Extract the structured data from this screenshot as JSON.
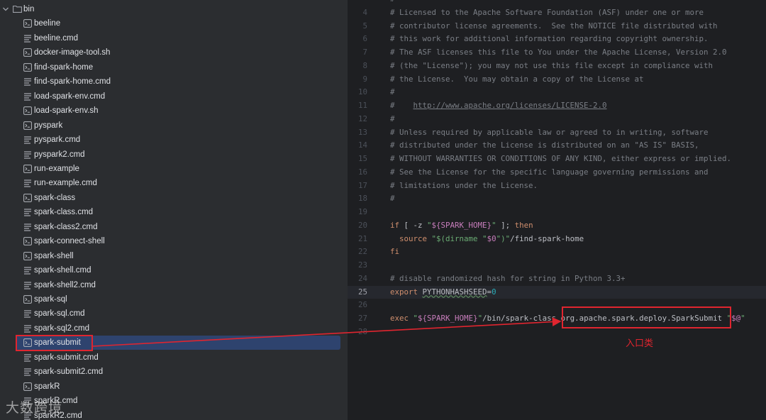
{
  "project_tree": {
    "folder": {
      "name": "bin",
      "expanded": true
    },
    "files": [
      {
        "name": "beeline",
        "icon": "terminal-icon"
      },
      {
        "name": "beeline.cmd",
        "icon": "text-file-icon"
      },
      {
        "name": "docker-image-tool.sh",
        "icon": "terminal-icon"
      },
      {
        "name": "find-spark-home",
        "icon": "terminal-icon"
      },
      {
        "name": "find-spark-home.cmd",
        "icon": "text-file-icon"
      },
      {
        "name": "load-spark-env.cmd",
        "icon": "text-file-icon"
      },
      {
        "name": "load-spark-env.sh",
        "icon": "terminal-icon"
      },
      {
        "name": "pyspark",
        "icon": "terminal-icon"
      },
      {
        "name": "pyspark.cmd",
        "icon": "text-file-icon"
      },
      {
        "name": "pyspark2.cmd",
        "icon": "text-file-icon"
      },
      {
        "name": "run-example",
        "icon": "terminal-icon"
      },
      {
        "name": "run-example.cmd",
        "icon": "text-file-icon"
      },
      {
        "name": "spark-class",
        "icon": "terminal-icon"
      },
      {
        "name": "spark-class.cmd",
        "icon": "text-file-icon"
      },
      {
        "name": "spark-class2.cmd",
        "icon": "text-file-icon"
      },
      {
        "name": "spark-connect-shell",
        "icon": "terminal-icon"
      },
      {
        "name": "spark-shell",
        "icon": "terminal-icon"
      },
      {
        "name": "spark-shell.cmd",
        "icon": "text-file-icon"
      },
      {
        "name": "spark-shell2.cmd",
        "icon": "text-file-icon"
      },
      {
        "name": "spark-sql",
        "icon": "terminal-icon"
      },
      {
        "name": "spark-sql.cmd",
        "icon": "text-file-icon"
      },
      {
        "name": "spark-sql2.cmd",
        "icon": "text-file-icon"
      },
      {
        "name": "spark-submit",
        "icon": "terminal-icon",
        "selected": true
      },
      {
        "name": "spark-submit.cmd",
        "icon": "text-file-icon"
      },
      {
        "name": "spark-submit2.cmd",
        "icon": "text-file-icon"
      },
      {
        "name": "sparkR",
        "icon": "terminal-icon"
      },
      {
        "name": "sparkR.cmd",
        "icon": "text-file-icon"
      },
      {
        "name": "sparkR2.cmd",
        "icon": "text-file-icon"
      }
    ]
  },
  "editor": {
    "current_line": 25,
    "lines": [
      {
        "n": "",
        "t": [
          [
            "c",
            "#"
          ]
        ]
      },
      {
        "n": "4",
        "t": [
          [
            "c",
            "# Licensed to the Apache Software Foundation (ASF) under one or more"
          ]
        ]
      },
      {
        "n": "5",
        "t": [
          [
            "c",
            "# contributor license agreements.  See the NOTICE file distributed with"
          ]
        ]
      },
      {
        "n": "6",
        "t": [
          [
            "c",
            "# this work for additional information regarding copyright ownership."
          ]
        ]
      },
      {
        "n": "7",
        "t": [
          [
            "c",
            "# The ASF licenses this file to You under the Apache License, Version 2.0"
          ]
        ]
      },
      {
        "n": "8",
        "t": [
          [
            "c",
            "# (the \"License\"); you may not use this file except in compliance with"
          ]
        ]
      },
      {
        "n": "9",
        "t": [
          [
            "c",
            "# the License.  You may obtain a copy of the License at"
          ]
        ]
      },
      {
        "n": "10",
        "t": [
          [
            "c",
            "#"
          ]
        ]
      },
      {
        "n": "11",
        "t": [
          [
            "c",
            "#    "
          ],
          [
            "l",
            "http://www.apache.org/licenses/LICENSE-2.0"
          ]
        ]
      },
      {
        "n": "12",
        "t": [
          [
            "c",
            "#"
          ]
        ]
      },
      {
        "n": "13",
        "t": [
          [
            "c",
            "# Unless required by applicable law or agreed to in writing, software"
          ]
        ]
      },
      {
        "n": "14",
        "t": [
          [
            "c",
            "# distributed under the License is distributed on an \"AS IS\" BASIS,"
          ]
        ]
      },
      {
        "n": "15",
        "t": [
          [
            "c",
            "# WITHOUT WARRANTIES OR CONDITIONS OF ANY KIND, either express or implied."
          ]
        ]
      },
      {
        "n": "16",
        "t": [
          [
            "c",
            "# See the License for the specific language governing permissions and"
          ]
        ]
      },
      {
        "n": "17",
        "t": [
          [
            "c",
            "# limitations under the License."
          ]
        ]
      },
      {
        "n": "18",
        "t": [
          [
            "c",
            "#"
          ]
        ]
      },
      {
        "n": "19",
        "t": []
      },
      {
        "n": "20",
        "t": [
          [
            "k",
            "if"
          ],
          [
            "p",
            " [ -z "
          ],
          [
            "s",
            "\""
          ],
          [
            "v",
            "${SPARK_HOME}"
          ],
          [
            "s",
            "\""
          ],
          [
            "p",
            " ]; "
          ],
          [
            "k",
            "then"
          ]
        ]
      },
      {
        "n": "21",
        "t": [
          [
            "p",
            "  "
          ],
          [
            "k",
            "source"
          ],
          [
            "p",
            " "
          ],
          [
            "s",
            "\"$(dirname \""
          ],
          [
            "v",
            "$0"
          ],
          [
            "s",
            "\")\""
          ],
          [
            "p",
            "/find-spark-home"
          ]
        ]
      },
      {
        "n": "22",
        "t": [
          [
            "k",
            "fi"
          ]
        ]
      },
      {
        "n": "23",
        "t": []
      },
      {
        "n": "24",
        "t": [
          [
            "c",
            "# disable randomized hash for string in Python 3.3+"
          ]
        ]
      },
      {
        "n": "25",
        "t": [
          [
            "k",
            "export"
          ],
          [
            "p",
            " "
          ],
          [
            "w",
            "PYTHONHASHSEED"
          ],
          [
            "p",
            "="
          ],
          [
            "d",
            "0"
          ]
        ]
      },
      {
        "n": "26",
        "t": []
      },
      {
        "n": "27",
        "t": [
          [
            "k",
            "exec"
          ],
          [
            "p",
            " "
          ],
          [
            "s",
            "\""
          ],
          [
            "v",
            "${SPARK_HOME}"
          ],
          [
            "s",
            "\""
          ],
          [
            "p",
            "/bin/spark-class "
          ],
          [
            "p",
            "org.apache.spark.deploy.SparkSubmit"
          ],
          [
            "p",
            " "
          ],
          [
            "s",
            "\""
          ],
          [
            "v",
            "$@"
          ],
          [
            "s",
            "\""
          ]
        ]
      },
      {
        "n": "28",
        "t": []
      }
    ]
  },
  "annotation": {
    "label": "入口类",
    "color": "#e0252f"
  },
  "watermark": "大数跨境"
}
